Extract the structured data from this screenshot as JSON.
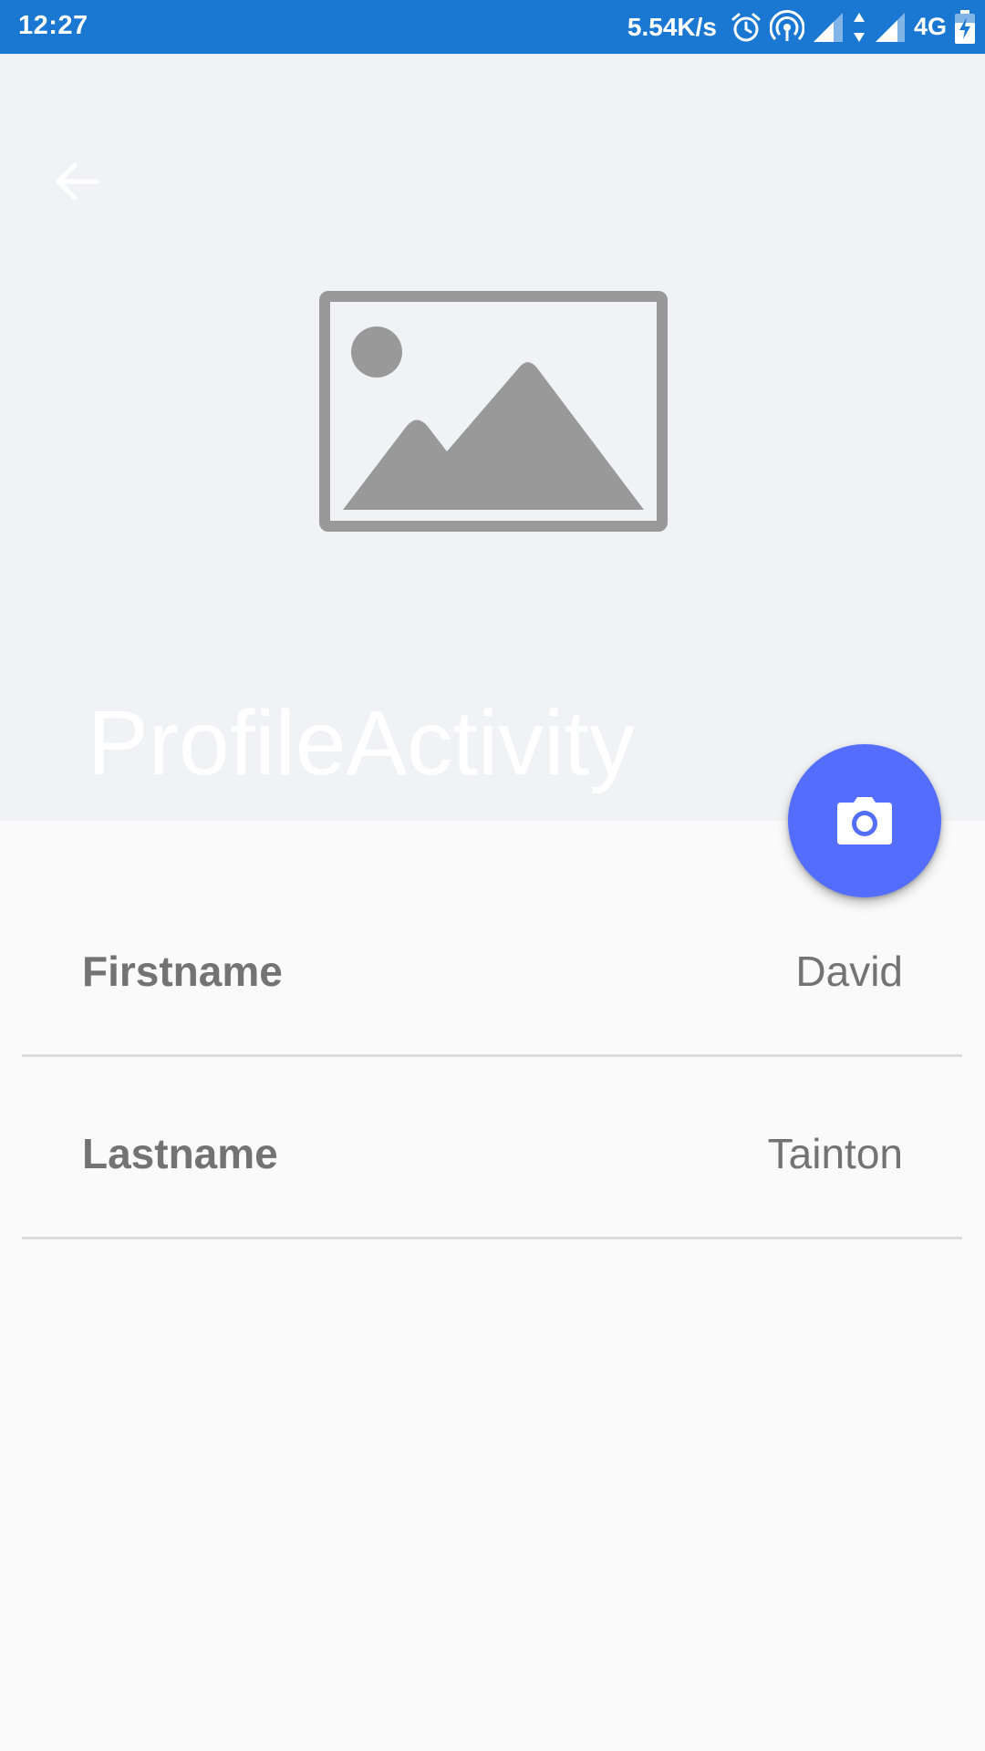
{
  "status_bar": {
    "time": "12:27",
    "network_speed": "5.54K/s",
    "network_type": "4G",
    "icons": [
      "alarm-icon",
      "hotspot-icon",
      "signal-icon",
      "data-arrows-icon",
      "signal-icon",
      "battery-charging-icon"
    ],
    "background_color": "#1a78d3"
  },
  "header": {
    "title": "ProfileActivity",
    "back_icon": "arrow-back-icon",
    "image_icon": "image-placeholder-icon",
    "background_color": "#f1f2f5"
  },
  "fab": {
    "icon": "camera-icon",
    "color": "#536dfe"
  },
  "profile": {
    "fields": [
      {
        "label": "Firstname",
        "value": "David"
      },
      {
        "label": "Lastname",
        "value": "Tainton"
      }
    ]
  }
}
